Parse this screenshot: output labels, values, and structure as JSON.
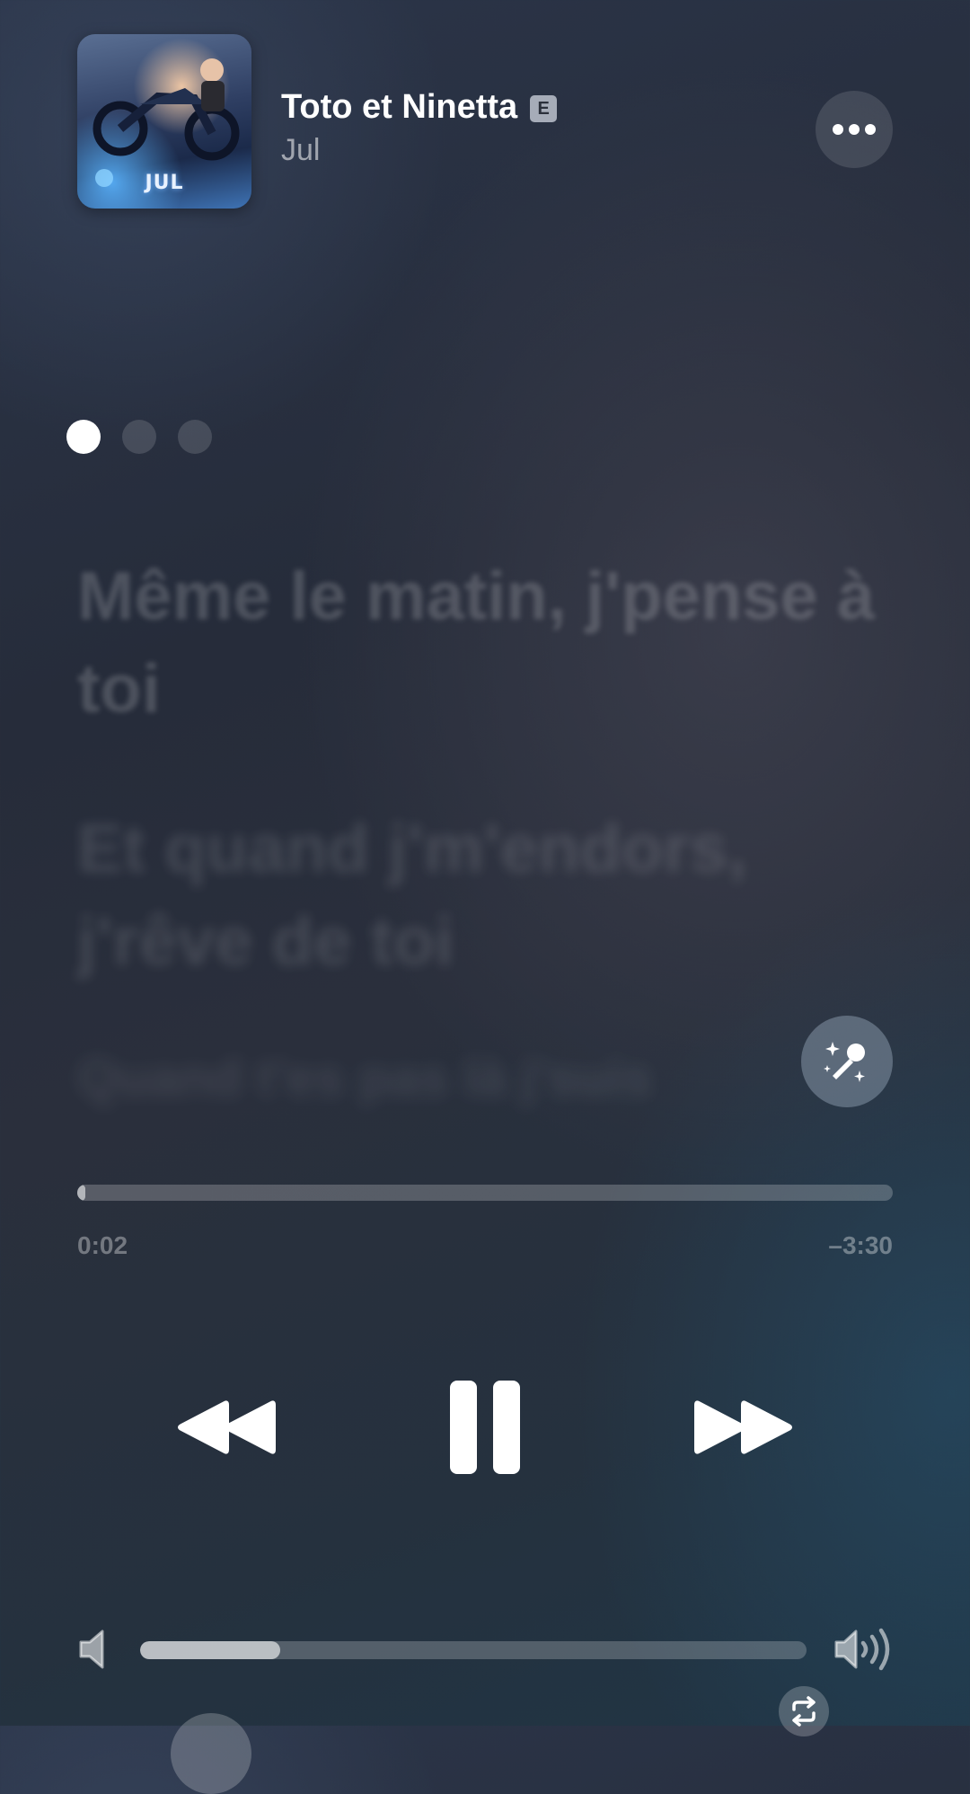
{
  "now_playing": {
    "title": "Toto et Ninetta",
    "explicit_badge": "E",
    "artist": "Jul",
    "artwork_label": "JUL",
    "more_icon": "ellipsis-icon"
  },
  "page_dots": {
    "count": 3,
    "active_index": 0
  },
  "lyrics": {
    "lines": [
      "Même le matin, j'pense à toi",
      "Et quand j'm'endors, j'rêve de toi",
      "Quand t'es pas là j'suis"
    ]
  },
  "sing_button": {
    "icon": "microphone-sparkles-icon"
  },
  "playback": {
    "elapsed": "0:02",
    "remaining": "–3:30",
    "progress_fraction": 0.01
  },
  "controls": {
    "rewind_icon": "backward-icon",
    "pause_icon": "pause-icon",
    "forward_icon": "forward-icon"
  },
  "volume": {
    "level_fraction": 0.21,
    "low_icon": "speaker-low-icon",
    "high_icon": "speaker-high-icon"
  },
  "bottom_bar": {
    "repeat_icon": "repeat-icon"
  },
  "colors": {
    "background": "#262c3a",
    "accent": "#ffffff"
  }
}
